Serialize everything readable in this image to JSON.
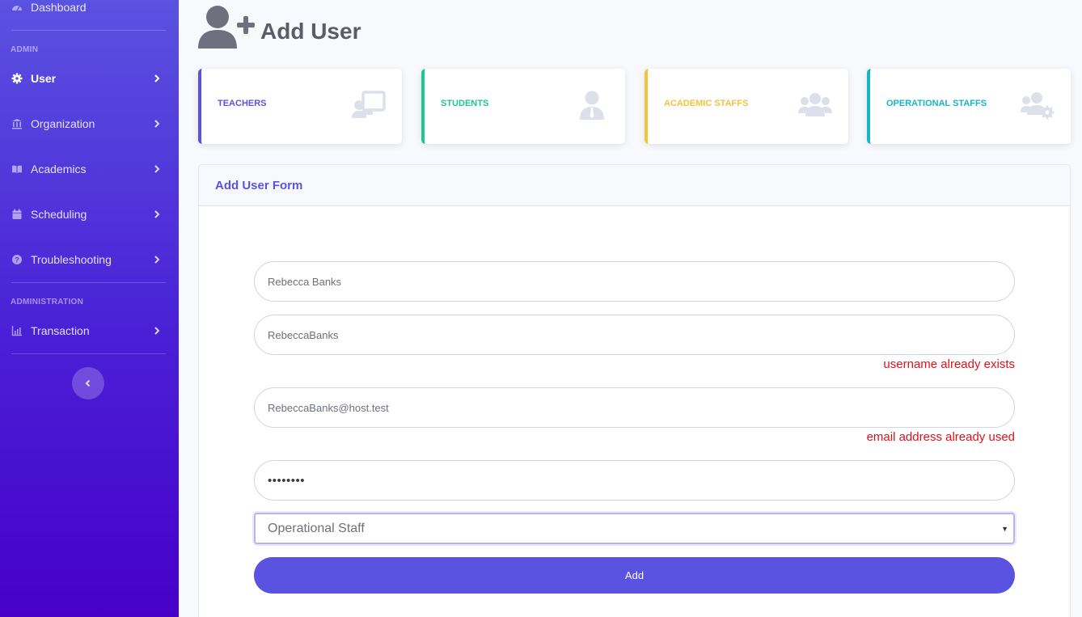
{
  "sidebar": {
    "dashboard_label": "Dashboard",
    "admin_heading": "ADMIN",
    "administration_heading": "ADMINISTRATION",
    "items": [
      {
        "label": "User",
        "icon": "gear-icon"
      },
      {
        "label": "Organization",
        "icon": "bank-icon"
      },
      {
        "label": "Academics",
        "icon": "book-icon"
      },
      {
        "label": "Scheduling",
        "icon": "calendar-icon"
      },
      {
        "label": "Troubleshooting",
        "icon": "question-circle-icon"
      },
      {
        "label": "Transaction",
        "icon": "chart-area-icon"
      }
    ]
  },
  "header": {
    "title": "Add User",
    "icon": "user-plus-icon"
  },
  "cards": [
    {
      "label": "TEACHERS",
      "color": "#5a52e0",
      "icon": "chalkboard-teacher-icon"
    },
    {
      "label": "STUDENTS",
      "color": "#1cc88a",
      "icon": "user-tie-icon"
    },
    {
      "label": "ACADEMIC STAFFS",
      "color": "#f6c23e",
      "icon": "users-icon"
    },
    {
      "label": "OPERATIONAL STAFFS",
      "color": "#17b5c6",
      "icon": "users-cog-icon"
    }
  ],
  "form": {
    "title": "Add User Form",
    "fullname_value": "Rebecca Banks",
    "username_value": "RebeccaBanks",
    "username_error": "username already exists",
    "email_value": "RebeccaBanks@host.test",
    "email_error": "email address already used",
    "password_value": "••••••••",
    "role_value": "Operational Staff",
    "submit_label": "Add"
  },
  "colors": {
    "accent": "#5a52e0",
    "error": "#e0101a"
  }
}
